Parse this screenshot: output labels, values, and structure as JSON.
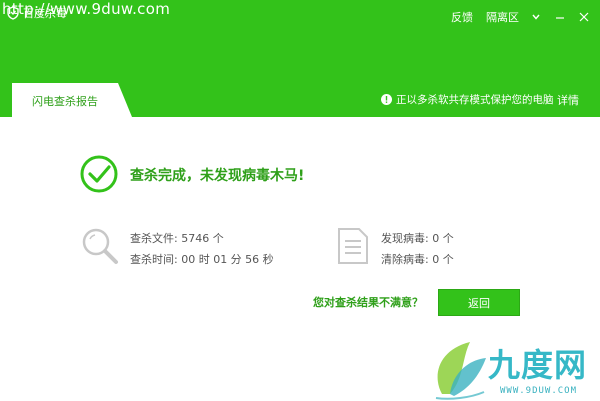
{
  "watermark": {
    "url": "http://www.9duw.com"
  },
  "app": {
    "title": "百度杀毒"
  },
  "top_links": {
    "feedback": "反馈",
    "quarantine": "隔离区"
  },
  "window_controls": [
    "chevron-down-icon",
    "minimize-icon",
    "close-icon"
  ],
  "tab": {
    "label": "闪电查杀报告"
  },
  "protection_note": {
    "text": "正以多杀软共存模式保护您的电脑",
    "details_link": "详情"
  },
  "result": {
    "title": "查杀完成，未发现病毒木马!"
  },
  "stats": {
    "files_scanned": "查杀文件: 5746 个",
    "scan_time": "查杀时间: 00 时 01 分 56 秒",
    "viruses_found": "发现病毒: 0 个",
    "viruses_cleaned": "清除病毒: 0 个"
  },
  "actions": {
    "dissatisfied_link": "您对查杀结果不满意？",
    "back_button": "返回"
  },
  "brand_watermark": {
    "logo_text": "九度网",
    "url": "WWW.9DUW.COM"
  },
  "colors": {
    "primary_green": "#33c21a",
    "text_green": "#2fa01a",
    "icon_gray": "#c8c8c8",
    "brand_teal": "#36b8c7"
  }
}
